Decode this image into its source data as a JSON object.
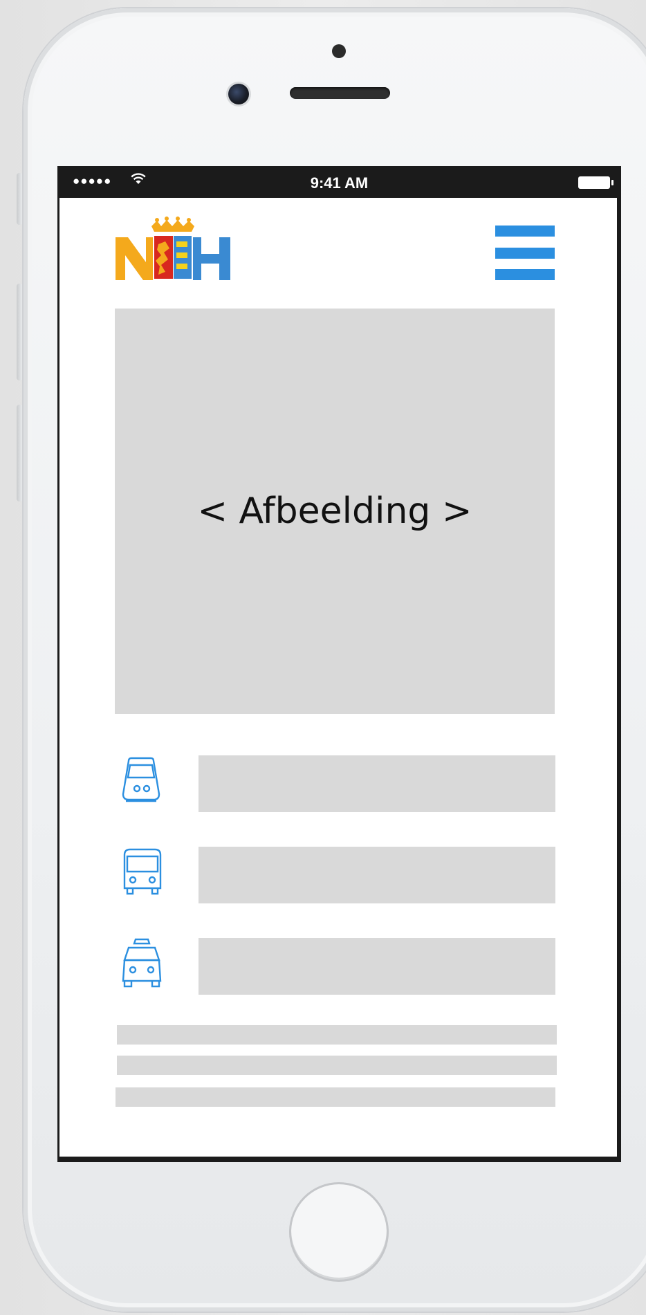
{
  "status_bar": {
    "signal": "●●●●●",
    "time": "9:41 AM"
  },
  "header": {
    "logo_text": "NH",
    "logo_colors": {
      "left": "#f4a91c",
      "right": "#3a8ad2",
      "crown": "#f4a91c",
      "shield_red": "#d8281f"
    },
    "menu_icon": "hamburger-menu-icon",
    "accent_color": "#2b8fe0"
  },
  "hero": {
    "label": "< Afbeelding >"
  },
  "transport_options": [
    {
      "icon": "tram-icon"
    },
    {
      "icon": "bus-icon"
    },
    {
      "icon": "taxi-icon"
    }
  ],
  "placeholder_color": "#d9d9d9"
}
